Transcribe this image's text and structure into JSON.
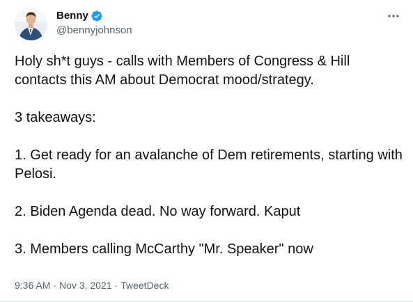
{
  "user": {
    "display_name": "Benny",
    "handle": "@bennyjohnson",
    "verified": true
  },
  "tweet": {
    "text": "Holy sh*t guys - calls with Members of Congress & Hill contacts this AM about Democrat mood/strategy.\n\n3 takeaways:\n\n1. Get ready for an avalanche of Dem retirements, starting with Pelosi.\n\n2. Biden Agenda dead. No way forward. Kaput\n\n3. Members calling McCarthy \"Mr. Speaker\" now",
    "time": "9:36 AM",
    "date": "Nov 3, 2021",
    "source": "TweetDeck",
    "separator": "·"
  },
  "icons": {
    "verified": "verified-badge-icon",
    "more": "more-options-icon"
  },
  "colors": {
    "verified": "#1d9bf0",
    "secondary_text": "#536471",
    "primary_text": "#0f1419"
  }
}
